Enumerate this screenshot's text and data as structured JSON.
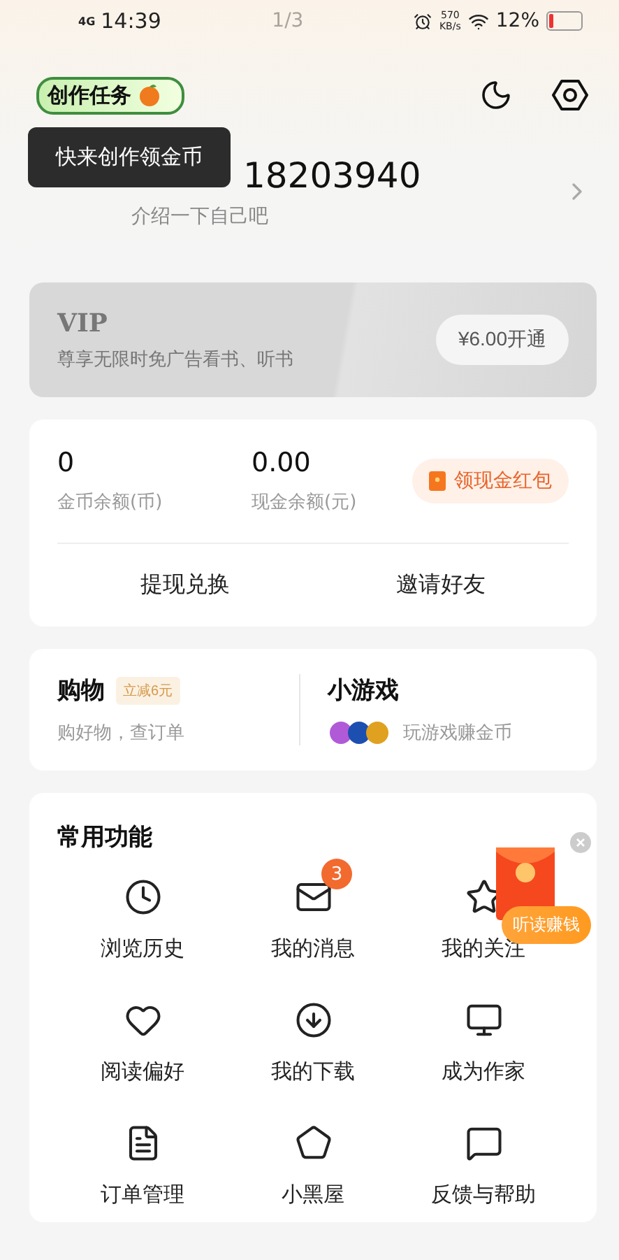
{
  "status_bar": {
    "network": "4G",
    "time": "14:39",
    "page_indicator": "1/3",
    "speed": "570",
    "speed_unit": "KB/s",
    "battery": "12%"
  },
  "header": {
    "task_badge": "创作任务",
    "tooltip": "快来创作领金币"
  },
  "profile": {
    "name": "18203940",
    "bio": "介绍一下自己吧"
  },
  "vip": {
    "title": "VIP",
    "subtitle": "尊享无限时免广告看书、听书",
    "button": "¥6.00开通"
  },
  "wallet": {
    "stats": [
      {
        "value": "0",
        "label": "金币余额(币)"
      },
      {
        "value": "0.00",
        "label": "现金余额(元)"
      }
    ],
    "red_packet_button": "领现金红包",
    "actions": [
      "提现兑换",
      "邀请好友"
    ]
  },
  "shortcuts": [
    {
      "kind": "shop",
      "title": "购物",
      "tag": "立减6元",
      "subtitle": "购好物，查订单"
    },
    {
      "kind": "games",
      "title": "小游戏",
      "subtitle": "玩游戏赚金币"
    }
  ],
  "functions": {
    "title": "常用功能",
    "items": [
      {
        "label": "浏览历史"
      },
      {
        "label": "我的消息"
      },
      {
        "label": "我的关注"
      },
      {
        "label": "阅读偏好"
      },
      {
        "label": "我的下载"
      },
      {
        "label": "成为作家"
      },
      {
        "label": "订单管理"
      },
      {
        "label": "小黑屋"
      },
      {
        "label": "反馈与帮助"
      }
    ],
    "messages_badge": "3"
  },
  "floating_promo": {
    "label": "听读赚钱"
  }
}
